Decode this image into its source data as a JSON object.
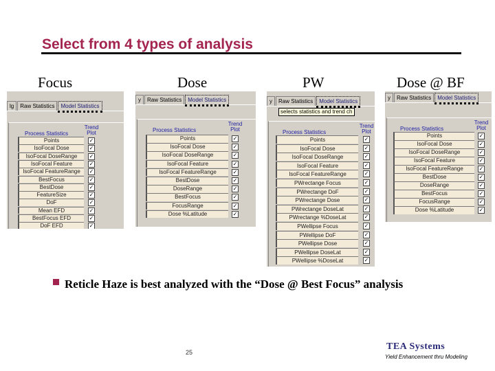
{
  "title": "Select from 4 types of analysis",
  "colors": {
    "title": "#a3244e",
    "logo": "#2a2a78",
    "row_bg": "#f3ead8",
    "panel_bg": "#d4d0c8"
  },
  "panels": [
    {
      "caption": "Focus",
      "tabs": [
        "lg",
        "Raw Statistics",
        "Model Statistics"
      ],
      "active_tab": 2,
      "heading": "Process Statistics",
      "trend": "Trend Plot",
      "items": [
        "Points",
        "IsoFocal Dose",
        "IsoFocal DoseRange",
        "IsoFocal Feature",
        "IsoFocal FeatureRange",
        "BestFocus",
        "BestDose",
        "FeatureSize",
        "DoF",
        "Mean EFD",
        "BestFocus EFD",
        "DoF EFD"
      ],
      "checked": [
        true,
        true,
        true,
        true,
        true,
        true,
        true,
        true,
        true,
        true,
        true,
        true
      ]
    },
    {
      "caption": "Dose",
      "tabs": [
        "y",
        "Raw Statistics",
        "Model Statistics"
      ],
      "active_tab": 2,
      "heading": "Process Statistics",
      "trend": "Trend Plot",
      "items": [
        "Points",
        "IsoFocal Dose",
        "IsoFocal DoseRange",
        "IsoFocal Feature",
        "IsoFocal FeatureRange",
        "BestDose",
        "DoseRange",
        "BestFocus",
        "FocusRange",
        "Dose %Latitude"
      ],
      "checked": [
        true,
        true,
        true,
        true,
        true,
        true,
        true,
        true,
        true,
        true
      ]
    },
    {
      "caption": "PW",
      "tabs": [
        "y",
        "Raw Statistics",
        "Model Statistics"
      ],
      "active_tab": 2,
      "tooltip": "selects statistics and trend ch",
      "heading": "Process Statistics",
      "trend": "Trend Plot",
      "items": [
        "Points",
        "IsoFocal Dose",
        "IsoFocal DoseRange",
        "IsoFocal Feature",
        "IsoFocal FeatureRange",
        "PWrectange Focus",
        "PWrectange DoF",
        "PWrectange Dose",
        "PWrectange DoseLat",
        "PWrectange %DoseLat",
        "PWellipse Focus",
        "PWellipse DoF",
        "PWellipse Dose",
        "PWellipse DoseLat",
        "PWellipse %DoseLat"
      ],
      "checked": [
        true,
        true,
        true,
        true,
        true,
        true,
        true,
        true,
        true,
        true,
        true,
        true,
        true,
        true,
        true
      ]
    },
    {
      "caption": "Dose @ BF",
      "tabs": [
        "y",
        "Raw Statistics",
        "Model Statistics"
      ],
      "active_tab": 2,
      "heading": "Process Statistics",
      "trend": "Trend Plot",
      "items": [
        "Points",
        "IsoFocal Dose",
        "IsoFocal DoseRange",
        "IsoFocal Feature",
        "IsoFocal FeatureRange",
        "BestDose",
        "DoseRange",
        "BestFocus",
        "FocusRange",
        "Dose %Latitude"
      ],
      "checked": [
        true,
        true,
        true,
        true,
        true,
        true,
        true,
        true,
        true,
        true
      ]
    }
  ],
  "bullet": {
    "icon": "square-bullet-icon",
    "text": "Reticle Haze is best analyzed with the “Dose @ Best Focus” analysis"
  },
  "footer": {
    "page_number": "25",
    "logo": "TEA Systems",
    "tagline": "Yield Enhancement thru Modeling"
  }
}
